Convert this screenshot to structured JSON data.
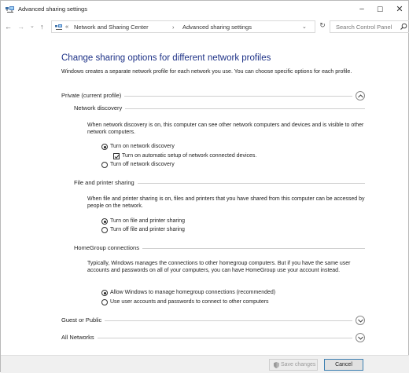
{
  "window": {
    "title": "Advanced sharing settings",
    "controls": {
      "minimize": "–",
      "maximize": "☐",
      "close": "✕"
    }
  },
  "nav": {
    "back": "←",
    "forward": "→",
    "recent": "⌄",
    "up": "↑",
    "address_prefix": "«",
    "breadcrumb": [
      "Network and Sharing Center",
      "Advanced sharing settings"
    ],
    "separator": "›",
    "refresh": "↻",
    "search_placeholder": "Search Control Panel"
  },
  "page": {
    "heading": "Change sharing options for different network profiles",
    "intro": "Windows creates a separate network profile for each network you use. You can choose specific options for each profile."
  },
  "profiles": {
    "private": {
      "label": "Private (current profile)",
      "expanded": true,
      "network_discovery": {
        "label": "Network discovery",
        "description": "When network discovery is on, this computer can see other network computers and devices and is visible to other network computers.",
        "options": {
          "on": "Turn on network discovery",
          "auto_setup": "Turn on automatic setup of network connected devices.",
          "off": "Turn off network discovery"
        },
        "selected": "on",
        "auto_setup_checked": true
      },
      "file_printer": {
        "label": "File and printer sharing",
        "description": "When file and printer sharing is on, files and printers that you have shared from this computer can be accessed by people on the network.",
        "options": {
          "on": "Turn on file and printer sharing",
          "off": "Turn off file and printer sharing"
        },
        "selected": "on"
      },
      "homegroup": {
        "label": "HomeGroup connections",
        "description": "Typically, Windows manages the connections to other homegroup computers. But if you have the same user accounts and passwords on all of your computers, you can have HomeGroup use your account instead.",
        "options": {
          "allow": "Allow Windows to manage homegroup connections (recommended)",
          "user": "Use user accounts and passwords to connect to other computers"
        },
        "selected": "allow"
      }
    },
    "guest": {
      "label": "Guest or Public",
      "expanded": false
    },
    "all": {
      "label": "All Networks",
      "expanded": false
    }
  },
  "footer": {
    "save": "Save changes",
    "save_enabled": false,
    "cancel": "Cancel"
  },
  "colors": {
    "heading": "#1e3287",
    "footer_bg": "#f0f0f0",
    "cancel_border": "#3c7fb1"
  }
}
